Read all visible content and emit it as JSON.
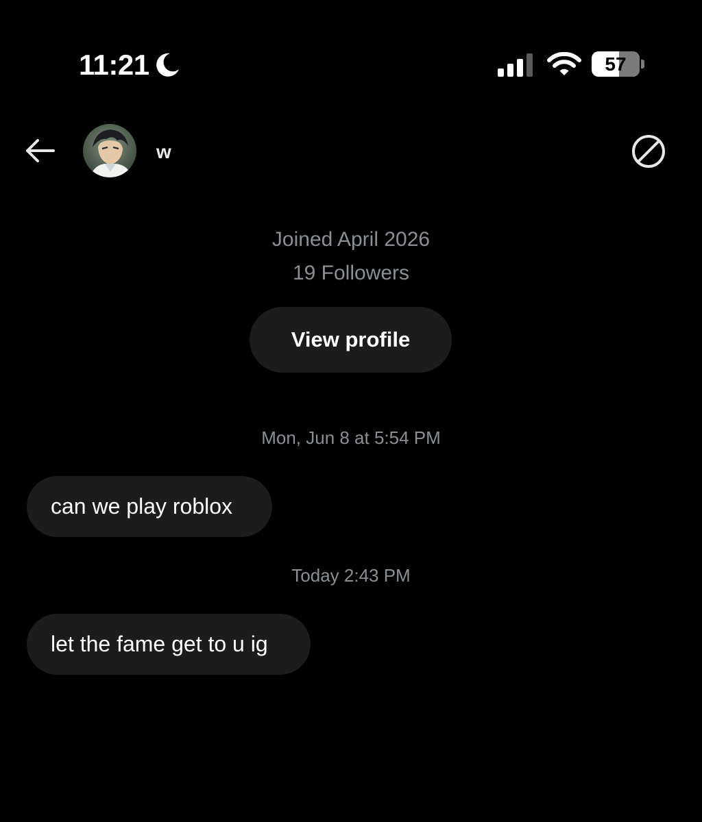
{
  "status_bar": {
    "time": "11:21",
    "focus_icon": "moon-icon",
    "signal_icon": "cellular-signal-icon",
    "signal_bars": 3,
    "wifi_icon": "wifi-icon",
    "battery_icon": "battery-icon",
    "battery_level": "57"
  },
  "header": {
    "back_icon": "arrow-left-icon",
    "avatar_icon": "avatar",
    "contact_name": "w",
    "block_icon": "block-icon"
  },
  "profile": {
    "joined": "Joined April 2026",
    "followers": "19 Followers",
    "view_profile_label": "View profile"
  },
  "messages": [
    {
      "timestamp": "Mon, Jun 8 at 5:54 PM",
      "text": "can we play roblox"
    },
    {
      "timestamp": "Today 2:43 PM",
      "text": "let the fame get to u ig"
    }
  ],
  "colors": {
    "background": "#000000",
    "bubble": "#1c1c1d",
    "secondary_text": "#8b8f94",
    "primary_text": "#ffffff"
  }
}
